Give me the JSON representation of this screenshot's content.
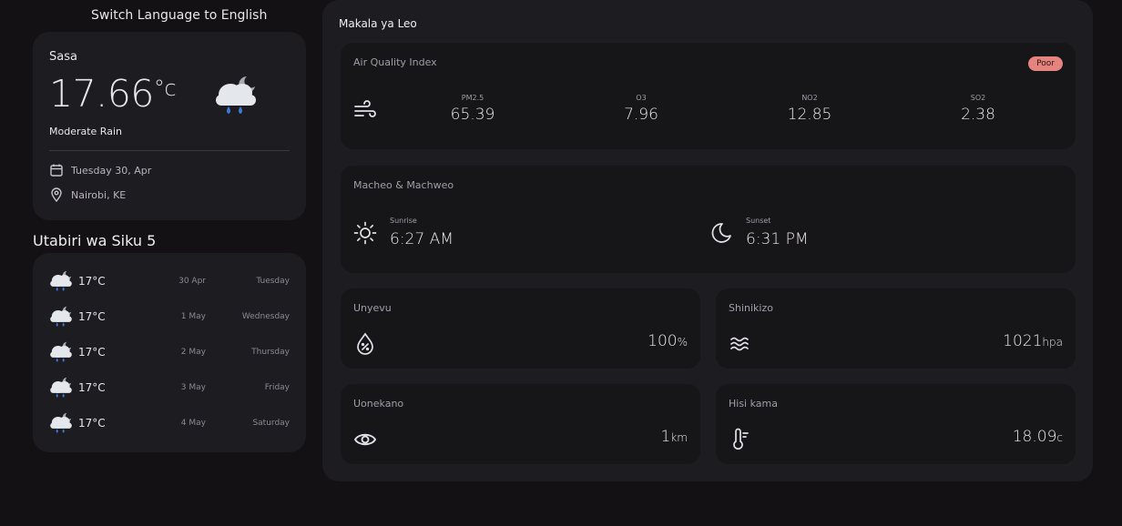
{
  "header": {
    "switch_language": "Switch Language to English"
  },
  "current": {
    "label": "Sasa",
    "temp": "17.66",
    "unit": "°c",
    "description": "Moderate Rain",
    "date": "Tuesday 30, Apr",
    "location": "Nairobi, KE",
    "icon": "rain-cloud-night-icon"
  },
  "forecast": {
    "title": "Utabiri wa Siku 5",
    "days": [
      {
        "temp": "17°C",
        "date": "30 Apr",
        "day": "Tuesday"
      },
      {
        "temp": "17°C",
        "date": "1 May",
        "day": "Wednesday"
      },
      {
        "temp": "17°C",
        "date": "2 May",
        "day": "Thursday"
      },
      {
        "temp": "17°C",
        "date": "3 May",
        "day": "Friday"
      },
      {
        "temp": "17°C",
        "date": "4 May",
        "day": "Saturday"
      }
    ]
  },
  "highlights": {
    "title": "Makala ya Leo",
    "aqi": {
      "title": "Air Quality Index",
      "badge": "Poor",
      "badge_color": "#e5837f",
      "items": [
        {
          "label": "PM2.5",
          "value": "65.39"
        },
        {
          "label": "O3",
          "value": "7.96"
        },
        {
          "label": "NO2",
          "value": "12.85"
        },
        {
          "label": "SO2",
          "value": "2.38"
        }
      ]
    },
    "sun": {
      "title": "Macheo & Machweo",
      "sunrise_label": "Sunrise",
      "sunrise": "6:27 AM",
      "sunset_label": "Sunset",
      "sunset": "6:31 PM"
    },
    "humidity": {
      "title": "Unyevu",
      "value": "100",
      "unit": "%"
    },
    "pressure": {
      "title": "Shinikizo",
      "value": "1021",
      "unit": "hpa"
    },
    "visibility": {
      "title": "Uonekano",
      "value": "1",
      "unit": "km"
    },
    "feels_like": {
      "title": "Hisi kama",
      "value": "18.09",
      "unit": "c"
    }
  }
}
